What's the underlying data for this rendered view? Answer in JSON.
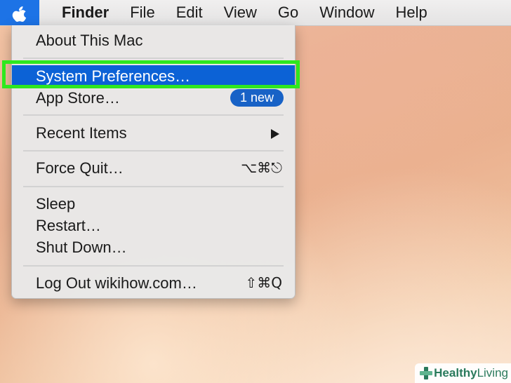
{
  "menubar": {
    "apple_icon": "apple-logo-icon",
    "app_name": "Finder",
    "menus": [
      "File",
      "Edit",
      "View",
      "Go",
      "Window",
      "Help"
    ]
  },
  "apple_menu": {
    "items": [
      {
        "label": "About This Mac"
      },
      {
        "label": "System Preferences…",
        "selected": true
      },
      {
        "label": "App Store…",
        "badge": "1 new"
      },
      {
        "label": "Recent Items",
        "submenu_icon": "triangle-right-icon"
      },
      {
        "label": "Force Quit…",
        "shortcut": "⌥⌘⎋"
      },
      {
        "label": "Sleep"
      },
      {
        "label": "Restart…"
      },
      {
        "label": "Shut Down…"
      },
      {
        "label": "Log Out wikihow.com…",
        "shortcut": "⇧⌘Q"
      }
    ]
  },
  "colors": {
    "selection_blue": "#0c62d6",
    "highlight_green": "#2ee81f",
    "apple_menu_active": "#1d73e6"
  },
  "watermark": {
    "brand_bold": "Healthy",
    "brand_light": "Living"
  }
}
